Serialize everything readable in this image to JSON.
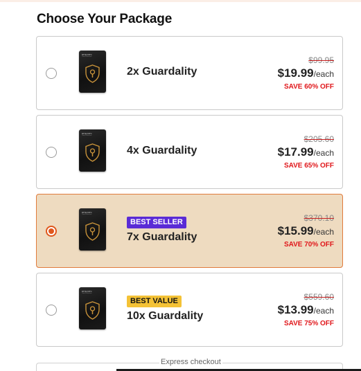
{
  "heading": "Choose Your Package",
  "card": {
    "brand": "RFID/NFC",
    "subtitle": "Card Protector"
  },
  "packages": [
    {
      "name": "2x Guardality",
      "badge": "",
      "original_price": "$99.95",
      "price": "$19.99",
      "unit": "/each",
      "save": "SAVE 60% OFF",
      "selected": false
    },
    {
      "name": "4x Guardality",
      "badge": "",
      "original_price": "$205.60",
      "price": "$17.99",
      "unit": "/each",
      "save": "SAVE 65% OFF",
      "selected": false
    },
    {
      "name": "7x Guardality",
      "badge": "BEST SELLER",
      "original_price": "$370.10",
      "price": "$15.99",
      "unit": "/each",
      "save": "SAVE 70% OFF",
      "selected": true
    },
    {
      "name": "10x Guardality",
      "badge": "BEST VALUE",
      "original_price": "$559.60",
      "price": "$13.99",
      "unit": "/each",
      "save": "SAVE 75% OFF",
      "selected": false
    }
  ],
  "express_checkout": "Express checkout",
  "colors": {
    "accent": "#e0571c",
    "selected_bg": "#eedbc0",
    "best_seller": "#5a2bd6",
    "best_value": "#f4c236",
    "save_red": "#e0161a"
  }
}
